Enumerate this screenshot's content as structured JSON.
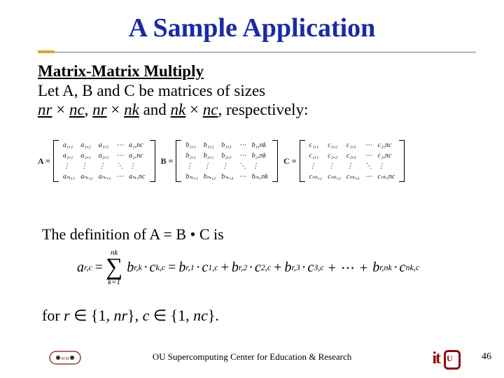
{
  "title": "A Sample Application",
  "subhead": "Matrix-Matrix Multiply",
  "intro_line1": "Let A, B and C be matrices of sizes",
  "intro_line2": {
    "nr": "nr",
    "x": "×",
    "nc": "nc",
    "nk": "nk",
    "sep": ", ",
    "and_word": " and ",
    "tail": ", respectively:"
  },
  "matrices": {
    "A": {
      "label": "A =",
      "rows": [
        [
          "a₁,₁",
          "a₁,₂",
          "a₁,₃",
          "⋯",
          "a₁,nc"
        ],
        [
          "a₂,₁",
          "a₂,₂",
          "a₂,₃",
          "⋯",
          "a₂,nc"
        ],
        [
          "⋮",
          "⋮",
          "⋮",
          "⋱",
          "⋮"
        ],
        [
          "aₙᵣ,₁",
          "aₙᵣ,₂",
          "aₙᵣ,₃",
          "⋯",
          "aₙᵣ,nc"
        ]
      ]
    },
    "B": {
      "label": "B =",
      "rows": [
        [
          "b₁,₁",
          "b₁,₂",
          "b₁,₃",
          "⋯",
          "b₁,nk"
        ],
        [
          "b₂,₁",
          "b₂,₂",
          "b₂,₃",
          "⋯",
          "b₂,nk"
        ],
        [
          "⋮",
          "⋮",
          "⋮",
          "⋱",
          "⋮"
        ],
        [
          "bₙᵣ,₁",
          "bₙᵣ,₂",
          "bₙᵣ,₃",
          "⋯",
          "bₙᵣ,nk"
        ]
      ]
    },
    "C": {
      "label": "C =",
      "rows": [
        [
          "c₁,₁",
          "c₁,₂",
          "c₁,₃",
          "⋯",
          "c₁,nc"
        ],
        [
          "c₂,₁",
          "c₂,₂",
          "c₂,₃",
          "⋯",
          "c₂,nc"
        ],
        [
          "⋮",
          "⋮",
          "⋮",
          "⋱",
          "⋮"
        ],
        [
          "cₙₖ,₁",
          "cₙₖ,₂",
          "cₙₖ,₃",
          "⋯",
          "cₙₖ,nc"
        ]
      ]
    }
  },
  "def_line": "The definition of  A = B • C  is",
  "formula": {
    "lhs": "a",
    "lhs_sub": "r,c",
    "sum_top": "nk",
    "sum_bottom": "k=1",
    "term_b": "b",
    "term_b_sub": "r,k",
    "term_c": "c",
    "term_c_sub": "k,c",
    "expand": [
      {
        "b": "b",
        "bs": "r,1",
        "c": "c",
        "cs": "1,c"
      },
      {
        "b": "b",
        "bs": "r,2",
        "c": "c",
        "cs": "2,c"
      },
      {
        "b": "b",
        "bs": "r,3",
        "c": "c",
        "cs": "3,c"
      }
    ],
    "ellipsis": "+ ⋯ +",
    "last": {
      "b": "b",
      "bs": "r,nk",
      "c": "c",
      "cs": "nk,c"
    }
  },
  "for_line": {
    "for_word": "for ",
    "r": "r",
    "in": " ∈ ",
    "set_r": "{1, ",
    "nr": "nr",
    "set_close": "}",
    "comma": ", ",
    "c": "c",
    "set_c": "{1, ",
    "nc": "nc",
    "period": "."
  },
  "footer": "OU Supercomputing Center for Education & Research",
  "pagenum": "46",
  "logos": {
    "it": "it"
  }
}
